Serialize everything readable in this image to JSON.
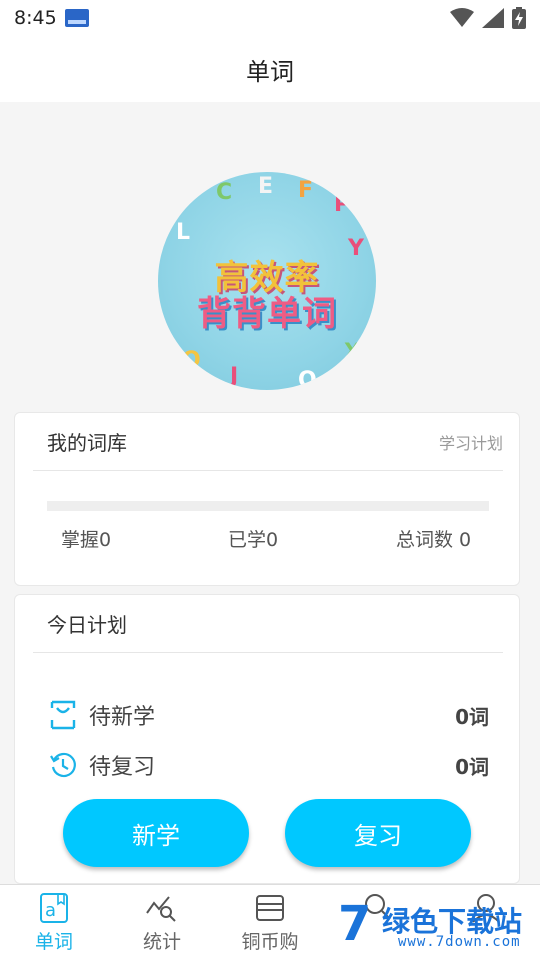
{
  "status_bar": {
    "time": "8:45",
    "icons": [
      "notification-icon",
      "wifi-icon",
      "signal-icon",
      "battery-charging-icon"
    ]
  },
  "header": {
    "title": "单词"
  },
  "hero": {
    "line1": "高效率",
    "line2": "背背单词"
  },
  "vocab_card": {
    "title": "我的词库",
    "plan_link": "学习计划",
    "progress": 0,
    "stats": {
      "mastered": "掌握0",
      "learned": "已学0",
      "total": "总词数 0"
    }
  },
  "today_card": {
    "title": "今日计划",
    "rows": [
      {
        "label": "待新学",
        "value": "0词",
        "icon": "new-learn-icon"
      },
      {
        "label": "待复习",
        "value": "0词",
        "icon": "review-history-icon"
      }
    ],
    "learn_button": "新学",
    "review_button": "复习"
  },
  "tabbar": {
    "items": [
      {
        "label": "单词",
        "icon": "word-icon",
        "active": true
      },
      {
        "label": "统计",
        "icon": "stats-icon",
        "active": false
      },
      {
        "label": "铜币购",
        "icon": "shop-icon",
        "active": false
      },
      {
        "label": "",
        "icon": "search-icon",
        "active": false
      },
      {
        "label": "",
        "icon": "user-icon",
        "active": false
      }
    ]
  },
  "watermark": {
    "text": "绿色下载站",
    "url": "www.7down.com"
  },
  "colors": {
    "accent": "#00c8ff",
    "active_tab": "#1ab3e8",
    "background": "#f5f5f5"
  }
}
